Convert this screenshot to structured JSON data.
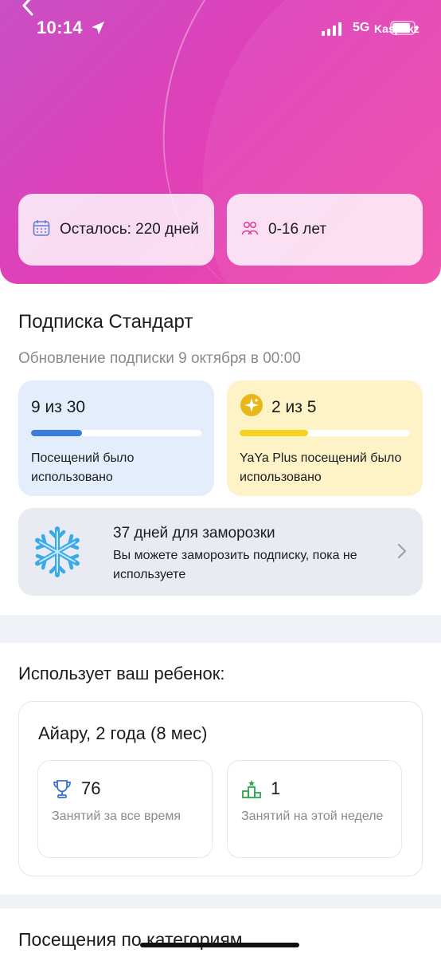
{
  "status_bar": {
    "time": "10:14",
    "network": "5G",
    "watermark": "Kaspi.kz"
  },
  "hero": {
    "remaining": "Осталось: 220 дней",
    "age_range": "0-16 лет"
  },
  "subscription": {
    "title": "Подписка Стандарт",
    "update_text": "Обновление подписки 9 октября в 00:00",
    "visits": {
      "count": "9 из 30",
      "progress": 0.3,
      "label": "Посещений было использовано",
      "color": "#3b7ddd"
    },
    "yaya_plus": {
      "count": "2 из 5",
      "progress": 0.4,
      "label": "YaYa Plus посещений было использовано",
      "color": "#f5d21b"
    },
    "freeze": {
      "title": "37 дней для заморозки",
      "description": "Вы можете заморозить подписку, пока не используете"
    }
  },
  "child": {
    "section_title": "Использует ваш ребенок:",
    "name": "Айару, 2 года (8 мес)",
    "total": {
      "value": "76",
      "label": "Занятий за все время"
    },
    "week": {
      "value": "1",
      "label": "Занятий на этой неделе"
    }
  },
  "categories": {
    "title": "Посещения по категориям"
  },
  "colors": {
    "hero_gradient": [
      "#c94fc4",
      "#f04aa8"
    ],
    "accent_blue": "#3b7ddd",
    "accent_yellow": "#f5d21b",
    "trophy_blue": "#3b6fd4",
    "podium_green": "#2ea84a"
  }
}
